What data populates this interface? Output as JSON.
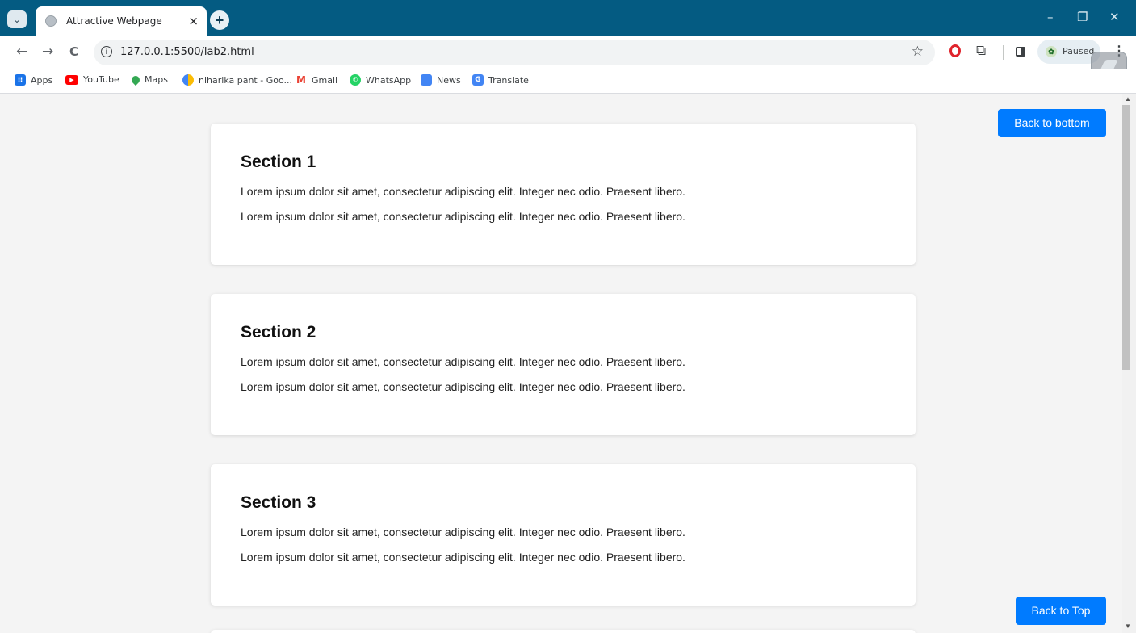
{
  "browser": {
    "tab_title": "Attractive Webpage",
    "tab_close": "×",
    "new_tab": "+",
    "tab_menu": "⌄",
    "window_controls": {
      "minimize": "–",
      "restore": "❐",
      "close": "✕"
    },
    "nav": {
      "back": "←",
      "forward": "→",
      "reload": "C"
    },
    "url": "127.0.0.1:5500/lab2.html",
    "site_info": "i",
    "bookmark_star": "☆",
    "profile_status": "Paused",
    "menu": "⋮"
  },
  "bookmarks": [
    {
      "label": "Apps",
      "icon": "apps-grid-icon",
      "color": "#1a73e8"
    },
    {
      "label": "YouTube",
      "icon": "youtube-icon",
      "color": "#ff0000"
    },
    {
      "label": "Maps",
      "icon": "maps-pin-icon",
      "color": "#34a853"
    },
    {
      "label": "niharika pant - Goo...",
      "icon": "photos-pinwheel-icon",
      "color": "#fbbc04"
    },
    {
      "label": "Gmail",
      "icon": "gmail-icon",
      "color": "#ea4335"
    },
    {
      "label": "WhatsApp",
      "icon": "whatsapp-icon",
      "color": "#25d366"
    },
    {
      "label": "News",
      "icon": "news-icon",
      "color": "#4285f4"
    },
    {
      "label": "Translate",
      "icon": "translate-icon",
      "color": "#4285f4"
    }
  ],
  "page": {
    "back_to_bottom": "Back to bottom",
    "back_to_top": "Back to Top",
    "accent": "#007bff",
    "sections": [
      {
        "title": "Section 1",
        "paragraphs": [
          "Lorem ipsum dolor sit amet, consectetur adipiscing elit. Integer nec odio. Praesent libero.",
          "Lorem ipsum dolor sit amet, consectetur adipiscing elit. Integer nec odio. Praesent libero."
        ]
      },
      {
        "title": "Section 2",
        "paragraphs": [
          "Lorem ipsum dolor sit amet, consectetur adipiscing elit. Integer nec odio. Praesent libero.",
          "Lorem ipsum dolor sit amet, consectetur adipiscing elit. Integer nec odio. Praesent libero."
        ]
      },
      {
        "title": "Section 3",
        "paragraphs": [
          "Lorem ipsum dolor sit amet, consectetur adipiscing elit. Integer nec odio. Praesent libero.",
          "Lorem ipsum dolor sit amet, consectetur adipiscing elit. Integer nec odio. Praesent libero."
        ]
      }
    ]
  }
}
